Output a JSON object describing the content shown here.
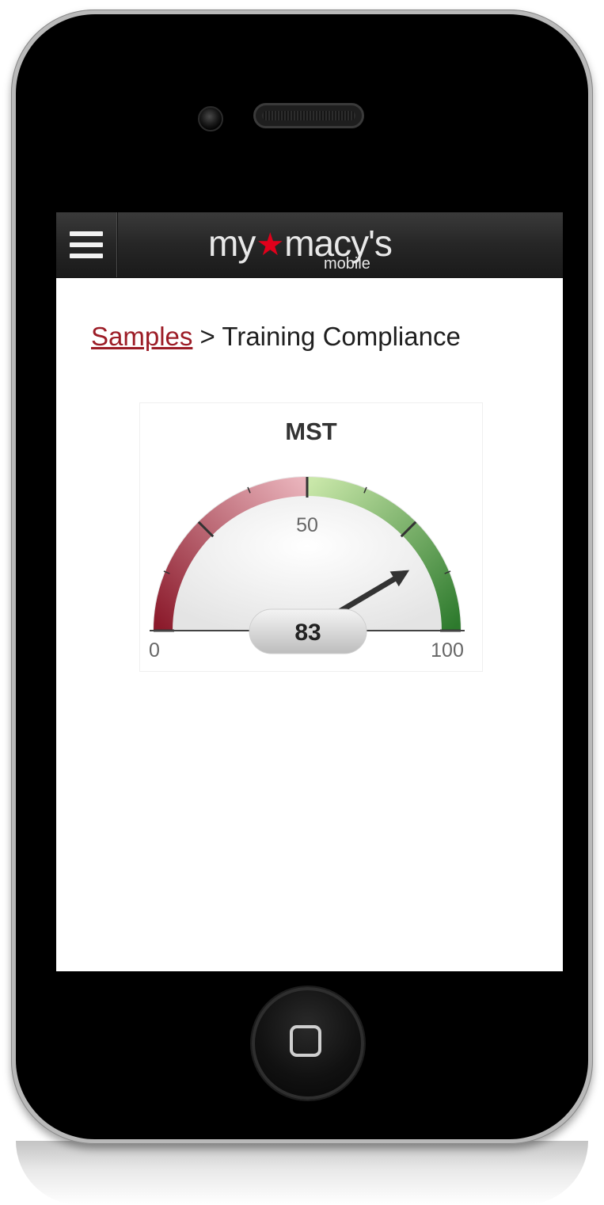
{
  "header": {
    "menu_icon": "hamburger-menu-icon",
    "logo_main_left": "my",
    "logo_star": "★",
    "logo_main_right": "macy's",
    "logo_sub": "mobile"
  },
  "breadcrumb": {
    "link": "Samples",
    "separator": " > ",
    "current": "Training Compliance"
  },
  "gauge": {
    "title": "MST",
    "min_label": "0",
    "mid_label": "50",
    "max_label": "100",
    "value_label": "83"
  },
  "colors": {
    "accent": "#9c1c26",
    "logo_star": "#e0001b",
    "gauge_low": "#8b1a2b",
    "gauge_high": "#2d7a2d"
  },
  "chart_data": {
    "type": "gauge",
    "title": "MST",
    "min": 0,
    "max": 100,
    "value": 83,
    "major_ticks": [
      0,
      25,
      50,
      75,
      100
    ],
    "tick_labels": [
      "0",
      "50",
      "100"
    ],
    "bands": [
      {
        "from": 0,
        "to": 50,
        "color_start": "#8b1a2b",
        "color_end": "#e6a9b2"
      },
      {
        "from": 50,
        "to": 100,
        "color_start": "#c8e6a8",
        "color_end": "#2d7a2d"
      }
    ]
  }
}
